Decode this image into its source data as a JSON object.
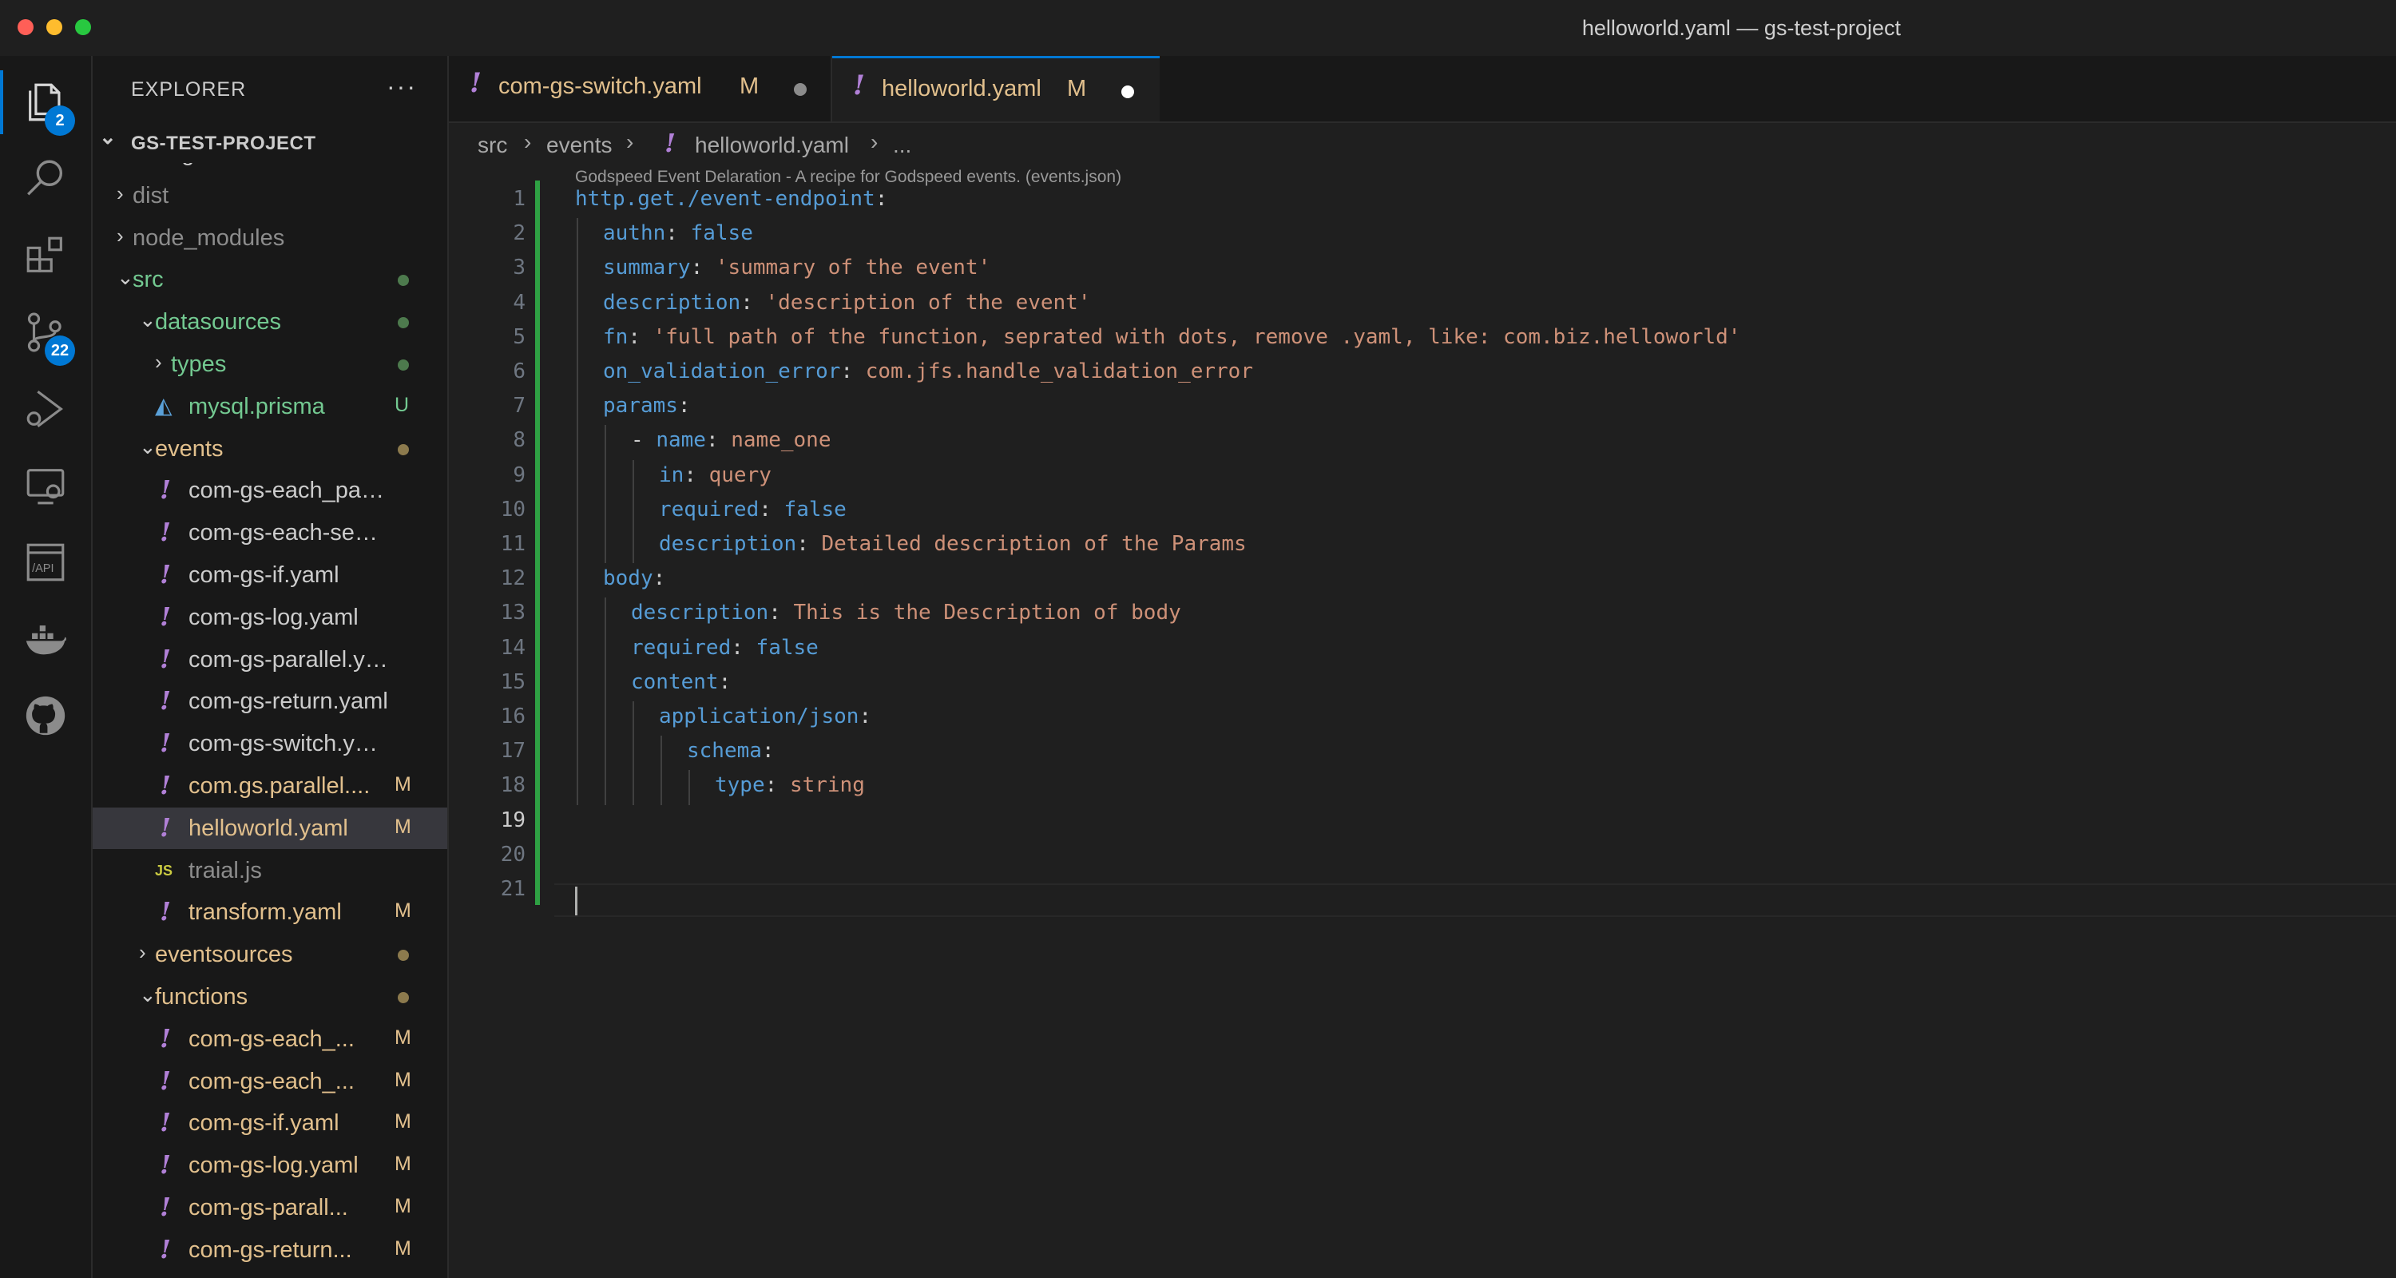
{
  "window": {
    "title": "helloworld.yaml — gs-test-project",
    "traffic_colors": [
      "#ff5f57",
      "#febc2e",
      "#28c840"
    ]
  },
  "activity_bar": {
    "items": [
      {
        "icon": "files-icon",
        "badge": "2"
      },
      {
        "icon": "search-icon",
        "badge": ""
      },
      {
        "icon": "extensions-icon",
        "badge": ""
      },
      {
        "icon": "source-control-icon",
        "badge": "22"
      },
      {
        "icon": "run-debug-icon",
        "badge": ""
      },
      {
        "icon": "remote-explorer-icon",
        "badge": ""
      },
      {
        "icon": "api-icon",
        "badge": ""
      },
      {
        "icon": "docker-icon",
        "badge": ""
      },
      {
        "icon": "github-icon",
        "badge": ""
      }
    ]
  },
  "explorer": {
    "title": "EXPLORER",
    "more": "···",
    "project": "GS-TEST-PROJECT",
    "rows": [
      {
        "name": "config",
        "kind": "folder",
        "depth": 0,
        "open": false,
        "status": "",
        "dot": "",
        "color": "#cccccc"
      },
      {
        "name": "dist",
        "kind": "folder",
        "depth": 0,
        "open": false,
        "status": "",
        "dot": "",
        "color": "#8c8c8c"
      },
      {
        "name": "node_modules",
        "kind": "folder",
        "depth": 0,
        "open": false,
        "status": "",
        "dot": "",
        "color": "#8c8c8c"
      },
      {
        "name": "src",
        "kind": "folder",
        "depth": 0,
        "open": true,
        "status": "",
        "dot": "#4d7a4d",
        "color": "#73c991"
      },
      {
        "name": "datasources",
        "kind": "folder",
        "depth": 1,
        "open": true,
        "status": "",
        "dot": "#4d7a4d",
        "color": "#73c991"
      },
      {
        "name": "types",
        "kind": "folder",
        "depth": 2,
        "open": false,
        "status": "",
        "dot": "#4d7a4d",
        "color": "#73c991"
      },
      {
        "name": "mysql.prisma",
        "kind": "prisma",
        "depth": 2,
        "open": false,
        "status": "U",
        "dot": "",
        "color": "#73c991"
      },
      {
        "name": "events",
        "kind": "folder",
        "depth": 1,
        "open": true,
        "status": "",
        "dot": "#8c7a4d",
        "color": "#e2c08d"
      },
      {
        "name": "com-gs-each_parall...",
        "kind": "yaml",
        "depth": 2,
        "open": false,
        "status": "",
        "dot": "",
        "color": "#cccccc"
      },
      {
        "name": "com-gs-each-sequ...",
        "kind": "yaml",
        "depth": 2,
        "open": false,
        "status": "",
        "dot": "",
        "color": "#cccccc"
      },
      {
        "name": "com-gs-if.yaml",
        "kind": "yaml",
        "depth": 2,
        "open": false,
        "status": "",
        "dot": "",
        "color": "#cccccc"
      },
      {
        "name": "com-gs-log.yaml",
        "kind": "yaml",
        "depth": 2,
        "open": false,
        "status": "",
        "dot": "",
        "color": "#cccccc"
      },
      {
        "name": "com-gs-parallel.yaml",
        "kind": "yaml",
        "depth": 2,
        "open": false,
        "status": "",
        "dot": "",
        "color": "#cccccc"
      },
      {
        "name": "com-gs-return.yaml",
        "kind": "yaml",
        "depth": 2,
        "open": false,
        "status": "",
        "dot": "",
        "color": "#cccccc"
      },
      {
        "name": "com-gs-switch.yaml",
        "kind": "yaml",
        "depth": 2,
        "open": false,
        "status": "",
        "dot": "",
        "color": "#cccccc"
      },
      {
        "name": "com.gs.parallel....",
        "kind": "yaml",
        "depth": 2,
        "open": false,
        "status": "M",
        "dot": "",
        "color": "#e2c08d"
      },
      {
        "name": "helloworld.yaml",
        "kind": "yaml",
        "depth": 2,
        "open": false,
        "status": "M",
        "dot": "",
        "color": "#e2c08d",
        "selected": true
      },
      {
        "name": "traial.js",
        "kind": "js",
        "depth": 2,
        "open": false,
        "status": "",
        "dot": "",
        "color": "#8c8c8c"
      },
      {
        "name": "transform.yaml",
        "kind": "yaml",
        "depth": 2,
        "open": false,
        "status": "M",
        "dot": "",
        "color": "#e2c08d"
      },
      {
        "name": "eventsources",
        "kind": "folder",
        "depth": 1,
        "open": false,
        "status": "",
        "dot": "#8c7a4d",
        "color": "#e2c08d"
      },
      {
        "name": "functions",
        "kind": "folder",
        "depth": 1,
        "open": true,
        "status": "",
        "dot": "#8c7a4d",
        "color": "#e2c08d"
      },
      {
        "name": "com-gs-each_...",
        "kind": "yaml",
        "depth": 2,
        "open": false,
        "status": "M",
        "dot": "",
        "color": "#e2c08d"
      },
      {
        "name": "com-gs-each_...",
        "kind": "yaml",
        "depth": 2,
        "open": false,
        "status": "M",
        "dot": "",
        "color": "#e2c08d"
      },
      {
        "name": "com-gs-if.yaml",
        "kind": "yaml",
        "depth": 2,
        "open": false,
        "status": "M",
        "dot": "",
        "color": "#e2c08d"
      },
      {
        "name": "com-gs-log.yaml",
        "kind": "yaml",
        "depth": 2,
        "open": false,
        "status": "M",
        "dot": "",
        "color": "#e2c08d"
      },
      {
        "name": "com-gs-parall...",
        "kind": "yaml",
        "depth": 2,
        "open": false,
        "status": "M",
        "dot": "",
        "color": "#e2c08d"
      },
      {
        "name": "com-gs-return...",
        "kind": "yaml",
        "depth": 2,
        "open": false,
        "status": "M",
        "dot": "",
        "color": "#e2c08d"
      }
    ]
  },
  "tabs": [
    {
      "name": "com-gs-switch.yaml",
      "status": "M",
      "active": false
    },
    {
      "name": "helloworld.yaml",
      "status": "M",
      "active": true
    }
  ],
  "breadcrumb": [
    "src",
    "events",
    "helloworld.yaml",
    "..."
  ],
  "codelens": "Godspeed Event Delaration - A recipe for Godspeed events. (events.json)",
  "editor": {
    "active_line": 19,
    "lines": [
      {
        "indent": 0,
        "dash": false,
        "key": "http.get./event-endpoint",
        "value": ""
      },
      {
        "indent": 1,
        "dash": false,
        "key": "authn",
        "value": "false",
        "vclass": "k"
      },
      {
        "indent": 1,
        "dash": false,
        "key": "summary",
        "value": "'summary of the event'",
        "vclass": "s"
      },
      {
        "indent": 1,
        "dash": false,
        "key": "description",
        "value": "'description of the event'",
        "vclass": "s"
      },
      {
        "indent": 1,
        "dash": false,
        "key": "fn",
        "value": "'full path of the function, seprated with dots, remove .yaml, like: com.biz.helloworld'",
        "vclass": "s"
      },
      {
        "indent": 1,
        "dash": false,
        "key": "on_validation_error",
        "value": "com.jfs.handle_validation_error",
        "vclass": "s"
      },
      {
        "indent": 1,
        "dash": false,
        "key": "params",
        "value": ""
      },
      {
        "indent": 2,
        "dash": true,
        "key": "name",
        "value": "name_one",
        "vclass": "s"
      },
      {
        "indent": 3,
        "dash": false,
        "key": "in",
        "value": "query",
        "vclass": "s"
      },
      {
        "indent": 3,
        "dash": false,
        "key": "required",
        "value": "false",
        "vclass": "k"
      },
      {
        "indent": 3,
        "dash": false,
        "key": "description",
        "value": "Detailed description of the Params",
        "vclass": "s"
      },
      {
        "indent": 1,
        "dash": false,
        "key": "body",
        "value": ""
      },
      {
        "indent": 2,
        "dash": false,
        "key": "description",
        "value": "This is the Description of body",
        "vclass": "s"
      },
      {
        "indent": 2,
        "dash": false,
        "key": "required",
        "value": "false",
        "vclass": "k"
      },
      {
        "indent": 2,
        "dash": false,
        "key": "content",
        "value": ""
      },
      {
        "indent": 3,
        "dash": false,
        "key": "application/json",
        "value": ""
      },
      {
        "indent": 4,
        "dash": false,
        "key": "schema",
        "value": ""
      },
      {
        "indent": 5,
        "dash": false,
        "key": "type",
        "value": "string",
        "vclass": "s"
      },
      {
        "indent": 0,
        "dash": false,
        "key": "",
        "value": ""
      },
      {
        "indent": 0,
        "dash": false,
        "key": "",
        "value": ""
      },
      {
        "indent": 0,
        "dash": false,
        "key": "",
        "value": ""
      }
    ]
  }
}
